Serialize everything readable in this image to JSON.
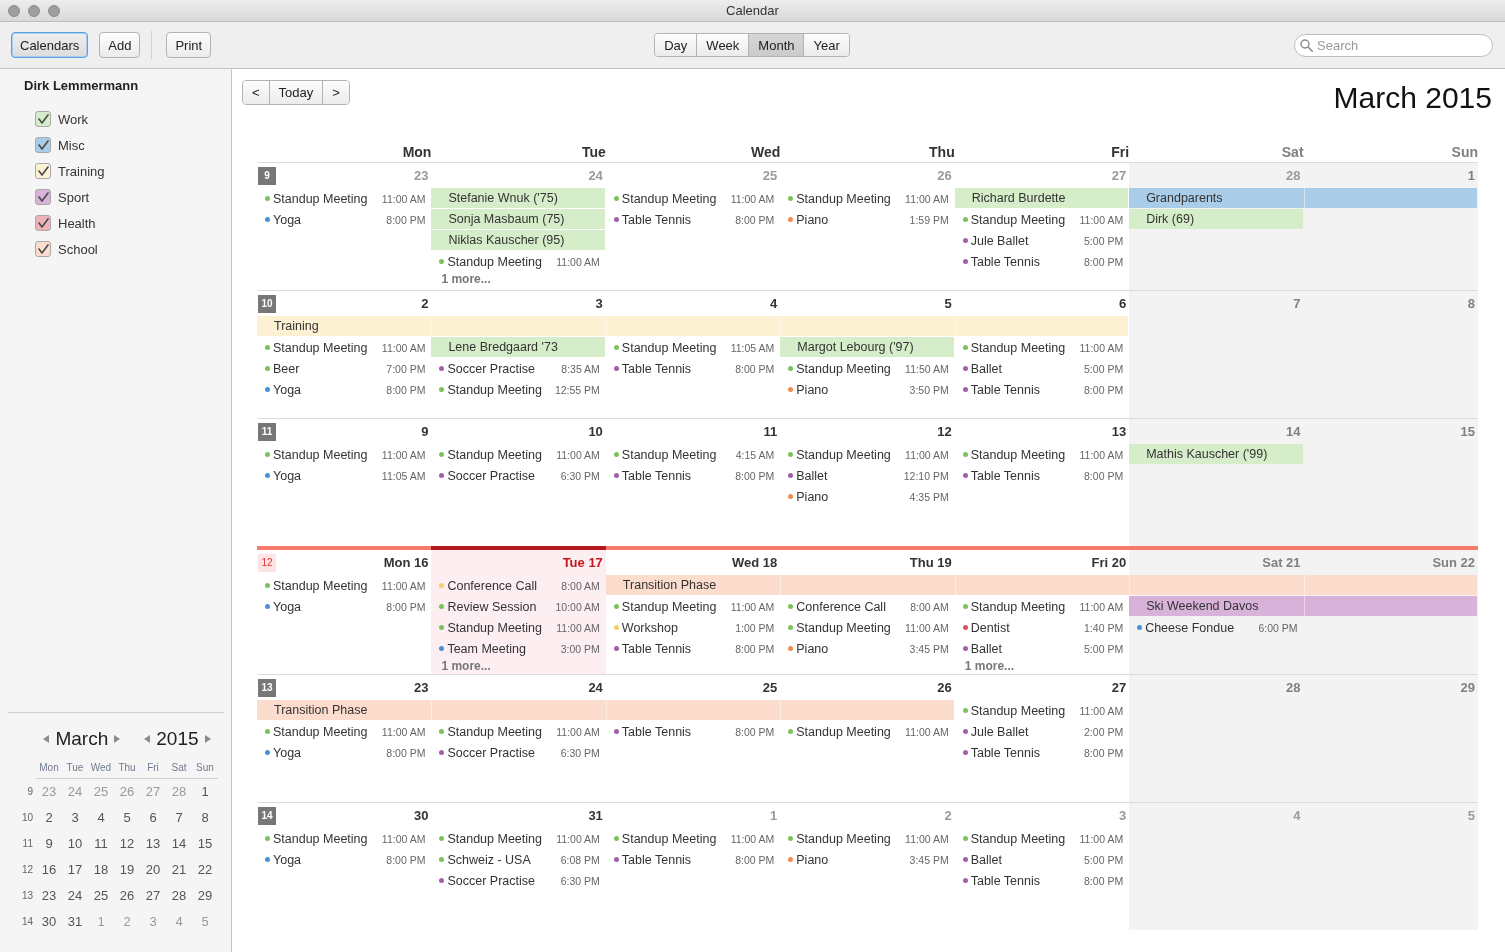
{
  "window": {
    "title": "Calendar"
  },
  "toolbar": {
    "button_groups": [
      [
        {
          "label": "Calendars",
          "selected": true
        },
        {
          "label": "Add",
          "selected": false
        }
      ],
      [
        {
          "label": "Print",
          "selected": false
        }
      ]
    ],
    "views": [
      {
        "label": "Day",
        "selected": false
      },
      {
        "label": "Week",
        "selected": false
      },
      {
        "label": "Month",
        "selected": true
      },
      {
        "label": "Year",
        "selected": false
      }
    ],
    "search": {
      "placeholder": "Search"
    }
  },
  "sidebar": {
    "owner": "Dirk Lemmermann",
    "calendars": [
      {
        "name": "Work",
        "color": "#d5edc9",
        "checked": true
      },
      {
        "name": "Misc",
        "color": "#a9cce9",
        "checked": true
      },
      {
        "name": "Training",
        "color": "#fdf1d3",
        "checked": true
      },
      {
        "name": "Sport",
        "color": "#d8b2d9",
        "checked": true
      },
      {
        "name": "Health",
        "color": "#edb3b9",
        "checked": true
      },
      {
        "name": "School",
        "color": "#fcdccd",
        "checked": true
      }
    ],
    "mini_calendar": {
      "month": "March",
      "year": "2015",
      "weekdays": [
        "Mon",
        "Tue",
        "Wed",
        "Thu",
        "Fri",
        "Sat",
        "Sun"
      ],
      "weeks": [
        {
          "number": "9",
          "days": [
            {
              "label": "23",
              "other_month": true
            },
            {
              "label": "24",
              "other_month": true
            },
            {
              "label": "25",
              "other_month": true
            },
            {
              "label": "26",
              "other_month": true
            },
            {
              "label": "27",
              "other_month": true
            },
            {
              "label": "28",
              "other_month": true
            },
            {
              "label": "1",
              "other_month": false
            }
          ]
        },
        {
          "number": "10",
          "days": [
            {
              "label": "2",
              "other_month": false
            },
            {
              "label": "3",
              "other_month": false
            },
            {
              "label": "4",
              "other_month": false
            },
            {
              "label": "5",
              "other_month": false
            },
            {
              "label": "6",
              "other_month": false
            },
            {
              "label": "7",
              "other_month": false
            },
            {
              "label": "8",
              "other_month": false
            }
          ]
        },
        {
          "number": "11",
          "days": [
            {
              "label": "9",
              "other_month": false
            },
            {
              "label": "10",
              "other_month": false
            },
            {
              "label": "11",
              "other_month": false
            },
            {
              "label": "12",
              "other_month": false
            },
            {
              "label": "13",
              "other_month": false
            },
            {
              "label": "14",
              "other_month": false
            },
            {
              "label": "15",
              "other_month": false
            }
          ]
        },
        {
          "number": "12",
          "days": [
            {
              "label": "16",
              "other_month": false
            },
            {
              "label": "17",
              "other_month": false
            },
            {
              "label": "18",
              "other_month": false
            },
            {
              "label": "19",
              "other_month": false
            },
            {
              "label": "20",
              "other_month": false
            },
            {
              "label": "21",
              "other_month": false
            },
            {
              "label": "22",
              "other_month": false
            }
          ]
        },
        {
          "number": "13",
          "days": [
            {
              "label": "23",
              "other_month": false
            },
            {
              "label": "24",
              "other_month": false
            },
            {
              "label": "25",
              "other_month": false
            },
            {
              "label": "26",
              "other_month": false
            },
            {
              "label": "27",
              "other_month": false
            },
            {
              "label": "28",
              "other_month": false
            },
            {
              "label": "29",
              "other_month": false
            }
          ]
        },
        {
          "number": "14",
          "days": [
            {
              "label": "30",
              "other_month": false
            },
            {
              "label": "31",
              "other_month": false
            },
            {
              "label": "1",
              "other_month": true
            },
            {
              "label": "2",
              "other_month": true
            },
            {
              "label": "3",
              "other_month": true
            },
            {
              "label": "4",
              "other_month": true
            },
            {
              "label": "5",
              "other_month": true
            }
          ]
        }
      ]
    }
  },
  "month_view": {
    "nav": [
      "<",
      "Today",
      ">"
    ],
    "title": "March 2015",
    "columns": [
      {
        "label": "Mon",
        "weekend": false
      },
      {
        "label": "Tue",
        "weekend": false
      },
      {
        "label": "Wed",
        "weekend": false
      },
      {
        "label": "Thu",
        "weekend": false
      },
      {
        "label": "Fri",
        "weekend": false
      },
      {
        "label": "Sat",
        "weekend": true
      },
      {
        "label": "Sun",
        "weekend": true
      }
    ],
    "weeks": [
      {
        "number": "9",
        "current": false,
        "days": [
          {
            "label": "23",
            "other_month": true,
            "today": false,
            "events": [
              {
                "title": "Standup Meeting",
                "time": "11:00 AM",
                "color": "#7ac35a"
              },
              {
                "title": "Yoga",
                "time": "8:00 PM",
                "color": "#4a90d9"
              }
            ]
          },
          {
            "label": "24",
            "other_month": true,
            "today": false,
            "all_day": [
              {
                "title": "Stefanie Wnuk ('75)",
                "color": "#d5edc9",
                "continued": false
              },
              {
                "title": "Sonja Masbaum (75)",
                "color": "#d5edc9",
                "continued": false
              },
              {
                "title": "Niklas Kauscher (95)",
                "color": "#d5edc9",
                "continued": false
              }
            ],
            "events": [
              {
                "title": "Standup Meeting",
                "time": "11:00 AM",
                "color": "#7ac35a"
              }
            ],
            "more": "1 more..."
          },
          {
            "label": "25",
            "other_month": true,
            "today": false,
            "events": [
              {
                "title": "Standup Meeting",
                "time": "11:00 AM",
                "color": "#7ac35a"
              },
              {
                "title": "Table Tennis",
                "time": "8:00 PM",
                "color": "#a45dab"
              }
            ]
          },
          {
            "label": "26",
            "other_month": true,
            "today": false,
            "events": [
              {
                "title": "Standup Meeting",
                "time": "11:00 AM",
                "color": "#7ac35a"
              },
              {
                "title": "Piano",
                "time": "1:59 PM",
                "color": "#f18b4f"
              }
            ]
          },
          {
            "label": "27",
            "other_month": true,
            "today": false,
            "all_day": [
              {
                "title": "Richard Burdette",
                "color": "#d5edc9",
                "continued": false
              }
            ],
            "events": [
              {
                "title": "Standup Meeting",
                "time": "11:00 AM",
                "color": "#7ac35a"
              },
              {
                "title": "Jule Ballet",
                "time": "5:00 PM",
                "color": "#a45dab"
              },
              {
                "title": "Table Tennis",
                "time": "8:00 PM",
                "color": "#a45dab"
              }
            ]
          },
          {
            "label": "28",
            "other_month": true,
            "today": false,
            "all_day": [
              {
                "title": "Grandparents",
                "color": "#a9cce9",
                "continued": false
              },
              {
                "title": "Dirk (69)",
                "color": "#d5edc9",
                "continued": false
              }
            ]
          },
          {
            "label": "1",
            "other_month": false,
            "today": false,
            "all_day": [
              {
                "color": "#a9cce9",
                "continued": true
              }
            ]
          }
        ]
      },
      {
        "number": "10",
        "current": false,
        "days": [
          {
            "label": "2",
            "other_month": false,
            "today": false,
            "all_day": [
              {
                "title": "Training",
                "color": "#fdf1d3",
                "continued": false
              }
            ],
            "events": [
              {
                "title": "Standup Meeting",
                "time": "11:00 AM",
                "color": "#7ac35a"
              },
              {
                "title": "Beer",
                "time": "7:00 PM",
                "color": "#7ac35a"
              },
              {
                "title": "Yoga",
                "time": "8:00 PM",
                "color": "#4a90d9"
              }
            ]
          },
          {
            "label": "3",
            "other_month": false,
            "today": false,
            "all_day": [
              {
                "color": "#fdf1d3",
                "continued": true
              },
              {
                "title": "Lene Bredgaard '73",
                "color": "#d5edc9",
                "continued": false
              }
            ],
            "events": [
              {
                "title": "Soccer Practise",
                "time": "8:35 AM",
                "color": "#a45dab"
              },
              {
                "title": "Standup Meeting",
                "time": "12:55 PM",
                "color": "#7ac35a"
              }
            ]
          },
          {
            "label": "4",
            "other_month": false,
            "today": false,
            "all_day": [
              {
                "color": "#fdf1d3",
                "continued": true
              }
            ],
            "events": [
              {
                "title": "Standup Meeting",
                "time": "11:05 AM",
                "color": "#7ac35a"
              },
              {
                "title": "Table Tennis",
                "time": "8:00 PM",
                "color": "#a45dab"
              }
            ]
          },
          {
            "label": "5",
            "other_month": false,
            "today": false,
            "all_day": [
              {
                "color": "#fdf1d3",
                "continued": true
              },
              {
                "title": "Margot Lebourg ('97)",
                "color": "#d5edc9",
                "continued": false
              }
            ],
            "events": [
              {
                "title": "Standup Meeting",
                "time": "11:50 AM",
                "color": "#7ac35a"
              },
              {
                "title": "Piano",
                "time": "3:50 PM",
                "color": "#f18b4f"
              }
            ]
          },
          {
            "label": "6",
            "other_month": false,
            "today": false,
            "all_day": [
              {
                "color": "#fdf1d3",
                "continued": true
              }
            ],
            "events": [
              {
                "title": "Standup Meeting",
                "time": "11:00 AM",
                "color": "#7ac35a"
              },
              {
                "title": "Ballet",
                "time": "5:00 PM",
                "color": "#a45dab"
              },
              {
                "title": "Table Tennis",
                "time": "8:00 PM",
                "color": "#a45dab"
              }
            ]
          },
          {
            "label": "7",
            "other_month": false,
            "today": false
          },
          {
            "label": "8",
            "other_month": false,
            "today": false
          }
        ]
      },
      {
        "number": "11",
        "current": false,
        "days": [
          {
            "label": "9",
            "other_month": false,
            "today": false,
            "events": [
              {
                "title": "Standup Meeting",
                "time": "11:00 AM",
                "color": "#7ac35a"
              },
              {
                "title": "Yoga",
                "time": "11:05 AM",
                "color": "#4a90d9"
              }
            ]
          },
          {
            "label": "10",
            "other_month": false,
            "today": false,
            "events": [
              {
                "title": "Standup Meeting",
                "time": "11:00 AM",
                "color": "#7ac35a"
              },
              {
                "title": "Soccer Practise",
                "time": "6:30 PM",
                "color": "#a45dab"
              }
            ]
          },
          {
            "label": "11",
            "other_month": false,
            "today": false,
            "events": [
              {
                "title": "Standup Meeting",
                "time": "4:15 AM",
                "color": "#7ac35a"
              },
              {
                "title": "Table Tennis",
                "time": "8:00 PM",
                "color": "#a45dab"
              }
            ]
          },
          {
            "label": "12",
            "other_month": false,
            "today": false,
            "events": [
              {
                "title": "Standup Meeting",
                "time": "11:00 AM",
                "color": "#7ac35a"
              },
              {
                "title": "Ballet",
                "time": "12:10 PM",
                "color": "#a45dab"
              },
              {
                "title": "Piano",
                "time": "4:35 PM",
                "color": "#f18b4f"
              }
            ]
          },
          {
            "label": "13",
            "other_month": false,
            "today": false,
            "events": [
              {
                "title": "Standup Meeting",
                "time": "11:00 AM",
                "color": "#7ac35a"
              },
              {
                "title": "Table Tennis",
                "time": "8:00 PM",
                "color": "#a45dab"
              }
            ]
          },
          {
            "label": "14",
            "other_month": false,
            "today": false,
            "all_day": [
              {
                "title": "Mathis Kauscher ('99)",
                "color": "#d5edc9",
                "continued": false
              }
            ]
          },
          {
            "label": "15",
            "other_month": false,
            "today": false
          }
        ]
      },
      {
        "number": "12",
        "current": true,
        "days": [
          {
            "label": "Mon 16",
            "other_month": false,
            "today": false,
            "events": [
              {
                "title": "Standup Meeting",
                "time": "11:00 AM",
                "color": "#7ac35a"
              },
              {
                "title": "Yoga",
                "time": "8:00 PM",
                "color": "#4a90d9"
              }
            ]
          },
          {
            "label": "Tue 17",
            "other_month": false,
            "today": true,
            "events": [
              {
                "title": "Conference Call",
                "time": "8:00 AM",
                "color": "#f4d163"
              },
              {
                "title": "Review Session",
                "time": "10:00 AM",
                "color": "#7ac35a"
              },
              {
                "title": "Standup Meeting",
                "time": "11:00 AM",
                "color": "#7ac35a"
              },
              {
                "title": "Team Meeting",
                "time": "3:00 PM",
                "color": "#4a90d9"
              }
            ],
            "more": "1 more..."
          },
          {
            "label": "Wed 18",
            "other_month": false,
            "today": false,
            "all_day": [
              {
                "title": "Transition Phase",
                "color": "#fcdccd",
                "continued": false
              }
            ],
            "events": [
              {
                "title": "Standup Meeting",
                "time": "11:00 AM",
                "color": "#7ac35a"
              },
              {
                "title": "Workshop",
                "time": "1:00 PM",
                "color": "#f4d163"
              },
              {
                "title": "Table Tennis",
                "time": "8:00 PM",
                "color": "#a45dab"
              }
            ]
          },
          {
            "label": "Thu 19",
            "other_month": false,
            "today": false,
            "all_day": [
              {
                "color": "#fcdccd",
                "continued": true
              }
            ],
            "events": [
              {
                "title": "Conference Call",
                "time": "8:00 AM",
                "color": "#7ac35a"
              },
              {
                "title": "Standup Meeting",
                "time": "11:00 AM",
                "color": "#7ac35a"
              },
              {
                "title": "Piano",
                "time": "3:45 PM",
                "color": "#f18b4f"
              }
            ]
          },
          {
            "label": "Fri 20",
            "other_month": false,
            "today": false,
            "all_day": [
              {
                "color": "#fcdccd",
                "continued": true
              }
            ],
            "events": [
              {
                "title": "Standup Meeting",
                "time": "11:00 AM",
                "color": "#7ac35a"
              },
              {
                "title": "Dentist",
                "time": "1:40 PM",
                "color": "#d9515f"
              },
              {
                "title": "Ballet",
                "time": "5:00 PM",
                "color": "#a45dab"
              }
            ],
            "more": "1 more..."
          },
          {
            "label": "Sat 21",
            "other_month": false,
            "today": false,
            "all_day": [
              {
                "color": "#fcdccd",
                "continued": true
              },
              {
                "title": "Ski Weekend Davos",
                "color": "#d8b2d9",
                "continued": false
              }
            ],
            "events": [
              {
                "title": "Cheese Fondue",
                "time": "6:00 PM",
                "color": "#4a90d9"
              }
            ]
          },
          {
            "label": "Sun 22",
            "other_month": false,
            "today": false,
            "all_day": [
              {
                "color": "#fcdccd",
                "continued": true
              },
              {
                "color": "#d8b2d9",
                "continued": true
              }
            ]
          }
        ]
      },
      {
        "number": "13",
        "current": false,
        "days": [
          {
            "label": "23",
            "other_month": false,
            "today": false,
            "all_day": [
              {
                "title": "Transition Phase",
                "color": "#fcdccd",
                "continued": false
              }
            ],
            "events": [
              {
                "title": "Standup Meeting",
                "time": "11:00 AM",
                "color": "#7ac35a"
              },
              {
                "title": "Yoga",
                "time": "8:00 PM",
                "color": "#4a90d9"
              }
            ]
          },
          {
            "label": "24",
            "other_month": false,
            "today": false,
            "all_day": [
              {
                "color": "#fcdccd",
                "continued": true
              }
            ],
            "events": [
              {
                "title": "Standup Meeting",
                "time": "11:00 AM",
                "color": "#7ac35a"
              },
              {
                "title": "Soccer Practise",
                "time": "6:30 PM",
                "color": "#a45dab"
              }
            ]
          },
          {
            "label": "25",
            "other_month": false,
            "today": false,
            "all_day": [
              {
                "color": "#fcdccd",
                "continued": true
              }
            ],
            "events": [
              {
                "title": "Table Tennis",
                "time": "8:00 PM",
                "color": "#a45dab"
              }
            ]
          },
          {
            "label": "26",
            "other_month": false,
            "today": false,
            "all_day": [
              {
                "color": "#fcdccd",
                "continued": true
              }
            ],
            "events": [
              {
                "title": "Standup Meeting",
                "time": "11:00 AM",
                "color": "#7ac35a"
              }
            ]
          },
          {
            "label": "27",
            "other_month": false,
            "today": false,
            "events": [
              {
                "title": "Standup Meeting",
                "time": "11:00 AM",
                "color": "#7ac35a"
              },
              {
                "title": "Jule Ballet",
                "time": "2:00 PM",
                "color": "#a45dab"
              },
              {
                "title": "Table Tennis",
                "time": "8:00 PM",
                "color": "#a45dab"
              }
            ]
          },
          {
            "label": "28",
            "other_month": false,
            "today": false
          },
          {
            "label": "29",
            "other_month": false,
            "today": false
          }
        ]
      },
      {
        "number": "14",
        "current": false,
        "days": [
          {
            "label": "30",
            "other_month": false,
            "today": false,
            "events": [
              {
                "title": "Standup Meeting",
                "time": "11:00 AM",
                "color": "#7ac35a"
              },
              {
                "title": "Yoga",
                "time": "8:00 PM",
                "color": "#4a90d9"
              }
            ]
          },
          {
            "label": "31",
            "other_month": false,
            "today": false,
            "events": [
              {
                "title": "Standup Meeting",
                "time": "11:00 AM",
                "color": "#7ac35a"
              },
              {
                "title": "Schweiz - USA",
                "time": "6:08 PM",
                "color": "#7ac35a"
              },
              {
                "title": "Soccer Practise",
                "time": "6:30 PM",
                "color": "#a45dab"
              }
            ]
          },
          {
            "label": "1",
            "other_month": true,
            "today": false,
            "events": [
              {
                "title": "Standup Meeting",
                "time": "11:00 AM",
                "color": "#7ac35a"
              },
              {
                "title": "Table Tennis",
                "time": "8:00 PM",
                "color": "#a45dab"
              }
            ]
          },
          {
            "label": "2",
            "other_month": true,
            "today": false,
            "events": [
              {
                "title": "Standup Meeting",
                "time": "11:00 AM",
                "color": "#7ac35a"
              },
              {
                "title": "Piano",
                "time": "3:45 PM",
                "color": "#f18b4f"
              }
            ]
          },
          {
            "label": "3",
            "other_month": true,
            "today": false,
            "events": [
              {
                "title": "Standup Meeting",
                "time": "11:00 AM",
                "color": "#7ac35a"
              },
              {
                "title": "Ballet",
                "time": "5:00 PM",
                "color": "#a45dab"
              },
              {
                "title": "Table Tennis",
                "time": "8:00 PM",
                "color": "#a45dab"
              }
            ]
          },
          {
            "label": "4",
            "other_month": true,
            "today": false
          },
          {
            "label": "5",
            "other_month": true,
            "today": false
          }
        ]
      }
    ]
  }
}
